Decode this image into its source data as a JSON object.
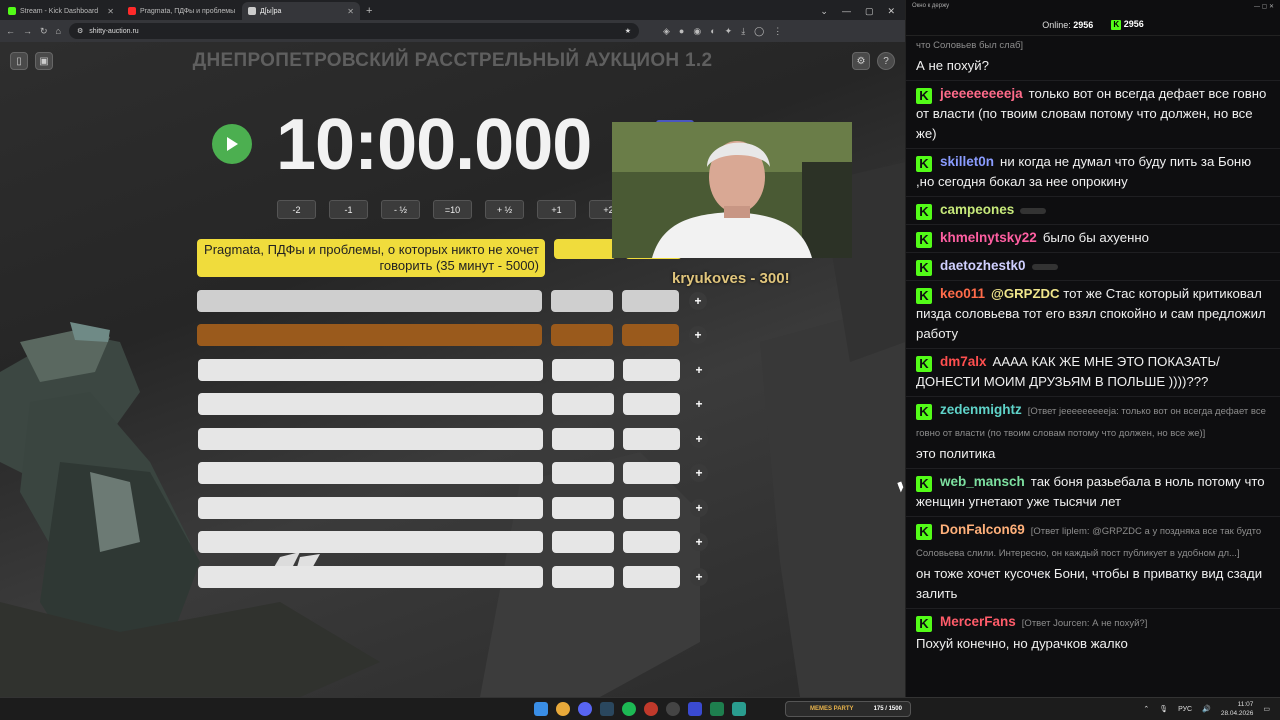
{
  "browser": {
    "tabs": [
      {
        "label": "Stream - Kick Dashboard",
        "fav_color": "#53fc18"
      },
      {
        "label": "Pragmata, ПДФы и проблемы",
        "fav_color": "#ff2a2a"
      },
      {
        "label": "Д[ы]ра",
        "fav_color": "#cccccc"
      }
    ],
    "url": "shitty-auction.ru"
  },
  "app": {
    "title": "ДНЕПРОПЕТРОВСКИЙ РАССТРЕЛЬНЫЙ АУКЦИОН 1.2",
    "timer": "10:00.000",
    "adjust_buttons": [
      "-2",
      "-1",
      "- ½",
      "=10",
      "+ ½",
      "+1",
      "+2"
    ],
    "lots": [
      {
        "name": "Pragmata, ПДФы и проблемы, о которых никто не хочет говорить (35 минут - 5000)",
        "style": "first"
      },
      {
        "name": "",
        "style": "gray"
      },
      {
        "name": "",
        "style": "brown"
      },
      {
        "name": "",
        "style": "white"
      },
      {
        "name": "",
        "style": "white"
      },
      {
        "name": "",
        "style": "white"
      },
      {
        "name": "",
        "style": "white"
      },
      {
        "name": "",
        "style": "white"
      },
      {
        "name": "",
        "style": "white"
      },
      {
        "name": "",
        "style": "white"
      }
    ],
    "plus_label": "+",
    "bid_overlay": "kryukoves - 300!"
  },
  "chat": {
    "window_title": "Окно к держу",
    "online_label": "Online:",
    "online_count": "2956",
    "kick_count": "2956",
    "messages": [
      {
        "user": "",
        "color": "#f0f0f0",
        "reply": "что Соловьев был слаб]",
        "text": "А не похуй?"
      },
      {
        "user": "jeeeeeeeeeja",
        "color": "#ff6b8a",
        "reply": "",
        "text": "только вот он всегда дефает все говно от власти (по твоим словам потому что должен, но все же)"
      },
      {
        "user": "skillet0n",
        "color": "#8a9cff",
        "reply": "",
        "text": "ни когда не думал что буду пить за Боню ,но сегодня бокал за нее опрокину"
      },
      {
        "user": "campeones",
        "color": "#c6e87a",
        "reply": "",
        "text": ""
      },
      {
        "user": "khmelnytsky22",
        "color": "#ff5fa2",
        "reply": "",
        "text": "было бы ахуенно"
      },
      {
        "user": "daetozhestk0",
        "color": "#d0d0ff",
        "reply": "",
        "text": ""
      },
      {
        "user": "keo011",
        "color": "#ff6b4a",
        "mention": "@GRPZDC",
        "reply": "",
        "text": "тот же Стас который критиковал пизда соловьева тот его взял спокойно и сам предложил работу"
      },
      {
        "user": "dm7alx",
        "color": "#ff4f4f",
        "reply": "",
        "text": "АААА КАК ЖЕ МНЕ ЭТО ПОКАЗАТЬ/ДОНЕСТИ МОИМ ДРУЗЬЯМ В ПОЛЬШЕ ))))???"
      },
      {
        "user": "zedenmightz",
        "color": "#5fd3c9",
        "reply": "[Ответ jeeeeeeeeeja: только вот он всегда дефает все говно от власти (по твоим словам потому что должен, но все же)]",
        "text": "это политика"
      },
      {
        "user": "web_mansch",
        "color": "#7de0a0",
        "reply": "",
        "text": "так боня разьебала в ноль потому что женщин угнетают уже тысячи лет"
      },
      {
        "user": "DonFalcon69",
        "color": "#ffb07a",
        "reply": "[Ответ liplem: @GRPZDC а у поздняка все так будто Соловьева слили. Интересно, он каждый пост публикует в удобном дл...]",
        "text": "он тоже хочет кусочек Бони, чтобы в приватку вид сзади залить"
      },
      {
        "user": "MercerFans",
        "color": "#ff5c6a",
        "reply": "[Ответ Jourcen: А не похуй?]",
        "text": "Похуй конечно, но дурачков жалко"
      }
    ]
  },
  "taskbar": {
    "memes_label": "MEMES PARTY",
    "memes_counter": "175 / 1500",
    "lang": "РУС",
    "time": "11:07",
    "date": "28.04.2026"
  }
}
